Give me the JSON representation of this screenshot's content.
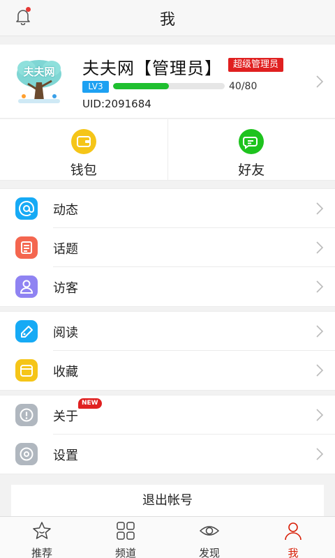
{
  "header": {
    "title": "我"
  },
  "profile": {
    "name": "夫夫网【管理员】",
    "role_badge": "超级管理员",
    "level": "LV3",
    "progress_fraction": 0.5,
    "progress_text": "40/80",
    "uid": "UID:2091684",
    "avatar_text": "夫夫网"
  },
  "tiles": [
    {
      "label": "钱包",
      "icon": "wallet-icon",
      "color": "#f5c518"
    },
    {
      "label": "好友",
      "icon": "chat-icon",
      "color": "#1ec31e"
    }
  ],
  "menu_groups": [
    [
      {
        "label": "动态",
        "icon": "at-icon",
        "color": "#16aaf5"
      },
      {
        "label": "话题",
        "icon": "topic-icon",
        "color": "#f4664f"
      },
      {
        "label": "访客",
        "icon": "person-icon",
        "color": "#8f83f2"
      }
    ],
    [
      {
        "label": "阅读",
        "icon": "tag-icon",
        "color": "#16aaf5"
      },
      {
        "label": "收藏",
        "icon": "folder-icon",
        "color": "#f5c518"
      }
    ],
    [
      {
        "label": "关于",
        "icon": "info-icon",
        "color": "#b0b7bf",
        "badge": "NEW"
      },
      {
        "label": "设置",
        "icon": "gear-icon",
        "color": "#b0b7bf"
      }
    ]
  ],
  "logout_label": "退出帐号",
  "bottom_nav": [
    {
      "label": "推荐",
      "icon": "star-icon"
    },
    {
      "label": "频道",
      "icon": "grid-icon"
    },
    {
      "label": "发现",
      "icon": "eye-icon"
    },
    {
      "label": "我",
      "icon": "user-icon",
      "active": true
    }
  ],
  "colors": {
    "accent": "#d81e06",
    "progress": "#1fbf2f",
    "level_badge": "#1da1f2",
    "admin_badge": "#e02020"
  }
}
